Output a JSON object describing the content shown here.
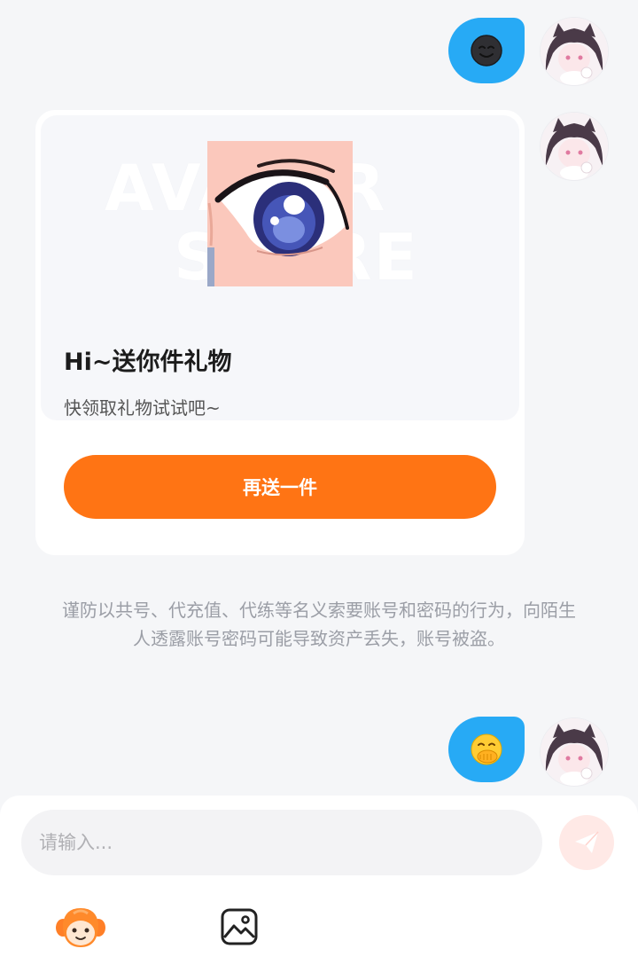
{
  "gift_card": {
    "watermark_line1": "AVATAR",
    "watermark_line2": "STORE",
    "title": "Hi~送你件礼物",
    "subtitle": "快领取礼物试试吧~",
    "button_label": "再送一件"
  },
  "warning_text": "谨防以共号、代充值、代练等名义索要账号和密码的行为，向陌生人透露账号密码可能导致资产丢失，账号被盗。",
  "composer": {
    "input_placeholder": "请输入..."
  },
  "colors": {
    "bubble": "#27aaf5",
    "accent": "#ff7414",
    "send_disabled": "#ffe9e6"
  },
  "icons": {
    "first_message_emoji": "dark-smiling-face-emoji",
    "second_message_emoji": "face-with-hand-over-mouth-emoji",
    "send": "paper-plane-icon",
    "sticker": "character-face-icon",
    "image": "image-icon"
  }
}
